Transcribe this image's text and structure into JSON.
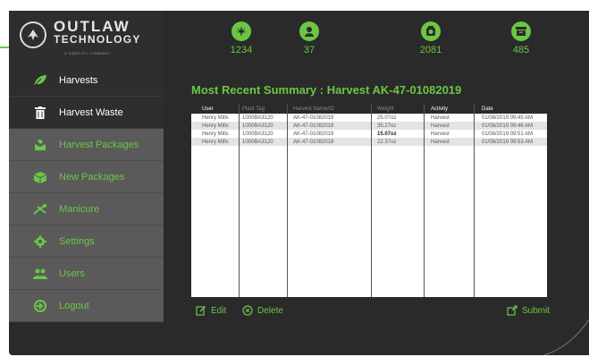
{
  "brand": {
    "name_line1": "OUTLAW",
    "name_line2": "TECHNOLOGY",
    "tagline": "A SIMPLIFY COMPANY"
  },
  "sidebar": {
    "items": [
      {
        "label": "Harvests",
        "icon": "leaf-icon",
        "style": "dark"
      },
      {
        "label": "Harvest Waste",
        "icon": "trash-icon",
        "style": "dark"
      },
      {
        "label": "Harvest Packages",
        "icon": "package-icon",
        "style": "light"
      },
      {
        "label": "New Packages",
        "icon": "box-icon",
        "style": "light"
      },
      {
        "label": "Manicure",
        "icon": "scissors-icon",
        "style": "light"
      },
      {
        "label": "Settings",
        "icon": "gear-icon",
        "style": "light"
      },
      {
        "label": "Users",
        "icon": "users-icon",
        "style": "light"
      },
      {
        "label": "Logout",
        "icon": "logout-icon",
        "style": "light"
      }
    ]
  },
  "stats": [
    {
      "icon": "cannabis-leaf-icon",
      "value": "1234"
    },
    {
      "icon": "user-icon",
      "value": "37"
    },
    {
      "icon": "scale-icon",
      "value": "2081"
    },
    {
      "icon": "archive-icon",
      "value": "485"
    }
  ],
  "summary_title": "Most Recent Summary : Harvest AK-47-01082019",
  "table": {
    "headers": [
      "User",
      "Plant Tag",
      "Harvest Name/ID",
      "Weight",
      "Activity",
      "Date"
    ],
    "rows": [
      [
        "Henry Mills",
        "1000BA3120",
        "AK-47-01082019",
        "25.07oz",
        "Harvest",
        "01/08/2019 09:45 AM"
      ],
      [
        "Henry Mills",
        "1000BA3120",
        "AK-47-01082019",
        "35.27oz",
        "Harvest",
        "01/08/2019 09:46 AM"
      ],
      [
        "Henry Mills",
        "1000BA3120",
        "AK-47-01082019",
        "15.07oz",
        "Harvest",
        "01/08/2019 09:51 AM"
      ],
      [
        "Henry Mills",
        "1000BA3120",
        "AK-47-01082019",
        "22.37oz",
        "Harvest",
        "01/08/2019 09:53 AM"
      ]
    ]
  },
  "actions": {
    "edit": "Edit",
    "delete": "Delete",
    "submit": "Submit"
  },
  "colors": {
    "accent": "#6cc644",
    "background": "#2a2a2a",
    "sidebar_dark": "#2e2e2e",
    "sidebar_light": "#5a5a5a"
  }
}
